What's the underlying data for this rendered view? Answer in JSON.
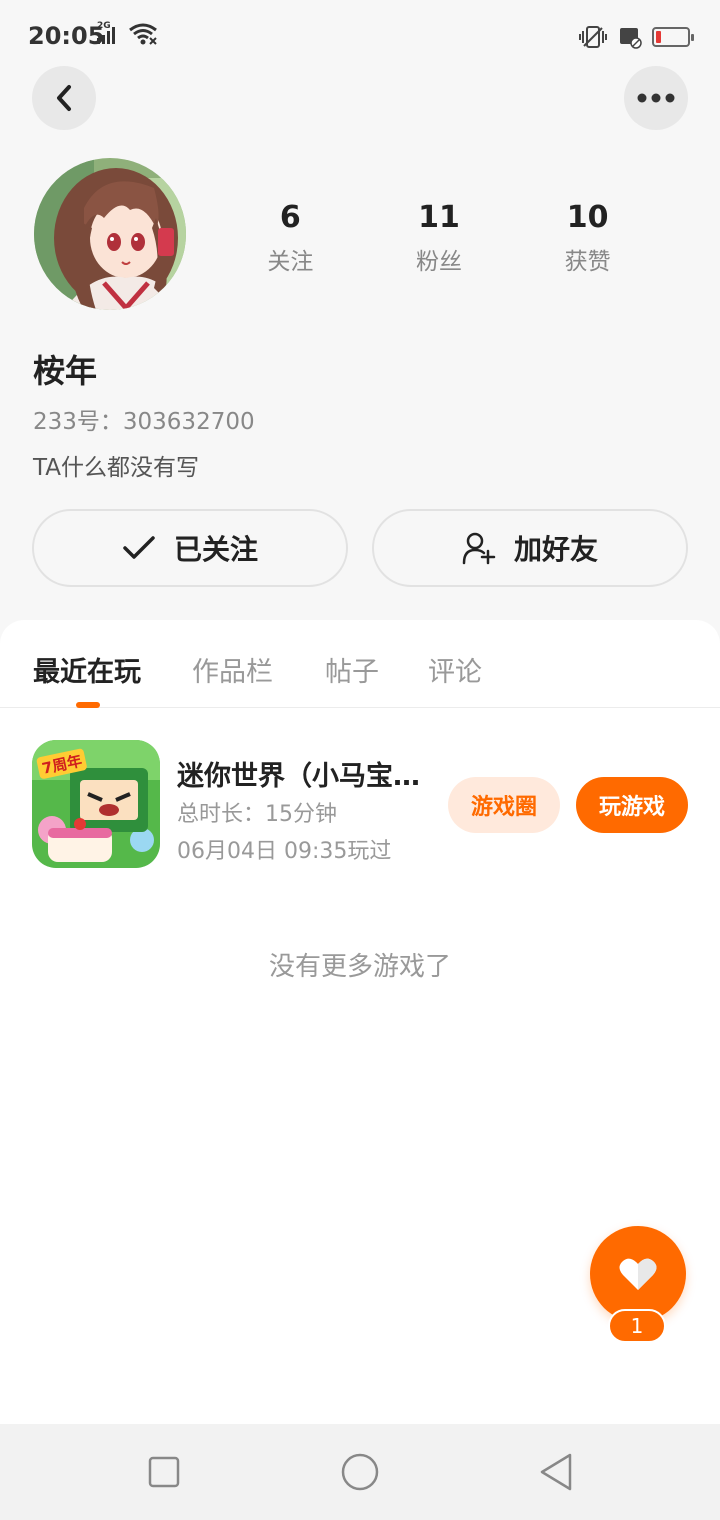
{
  "status_bar": {
    "time": "20:05",
    "network": "2G",
    "icons": [
      "signal-icon",
      "wifi-icon",
      "vibrate-icon",
      "sim-icon",
      "battery-icon"
    ],
    "battery_color": "#e53935"
  },
  "header": {
    "back_icon": "chevron-left-icon",
    "more_icon": "more-horizontal-icon"
  },
  "profile": {
    "avatar": "anime-girl-avatar",
    "username": "桉年",
    "user_id": "233号：303632700",
    "bio": "TA什么都没有写",
    "stats": [
      {
        "value": "6",
        "label": "关注"
      },
      {
        "value": "11",
        "label": "粉丝"
      },
      {
        "value": "10",
        "label": "获赞"
      }
    ]
  },
  "actions": {
    "follow_label": "已关注",
    "add_friend_label": "加好友"
  },
  "tabs": [
    {
      "label": "最近在玩",
      "active": true
    },
    {
      "label": "作品栏",
      "active": false
    },
    {
      "label": "帖子",
      "active": false
    },
    {
      "label": "评论",
      "active": false
    }
  ],
  "games": [
    {
      "title": "迷你世界（小马宝…",
      "duration": "总时长：15分钟",
      "last_played": "06月04日 09:35玩过",
      "icon_badge": "7周年",
      "circle_label": "游戏圈",
      "play_label": "玩游戏"
    }
  ],
  "empty_text": "没有更多游戏了",
  "fab": {
    "icon": "heart-icon",
    "count": "1"
  },
  "colors": {
    "accent": "#ff6a00",
    "accent_light": "#ffe9dc",
    "background": "#f7f7f7"
  },
  "nav_bar": {
    "buttons": [
      "recent-apps-icon",
      "home-icon",
      "back-icon"
    ]
  }
}
